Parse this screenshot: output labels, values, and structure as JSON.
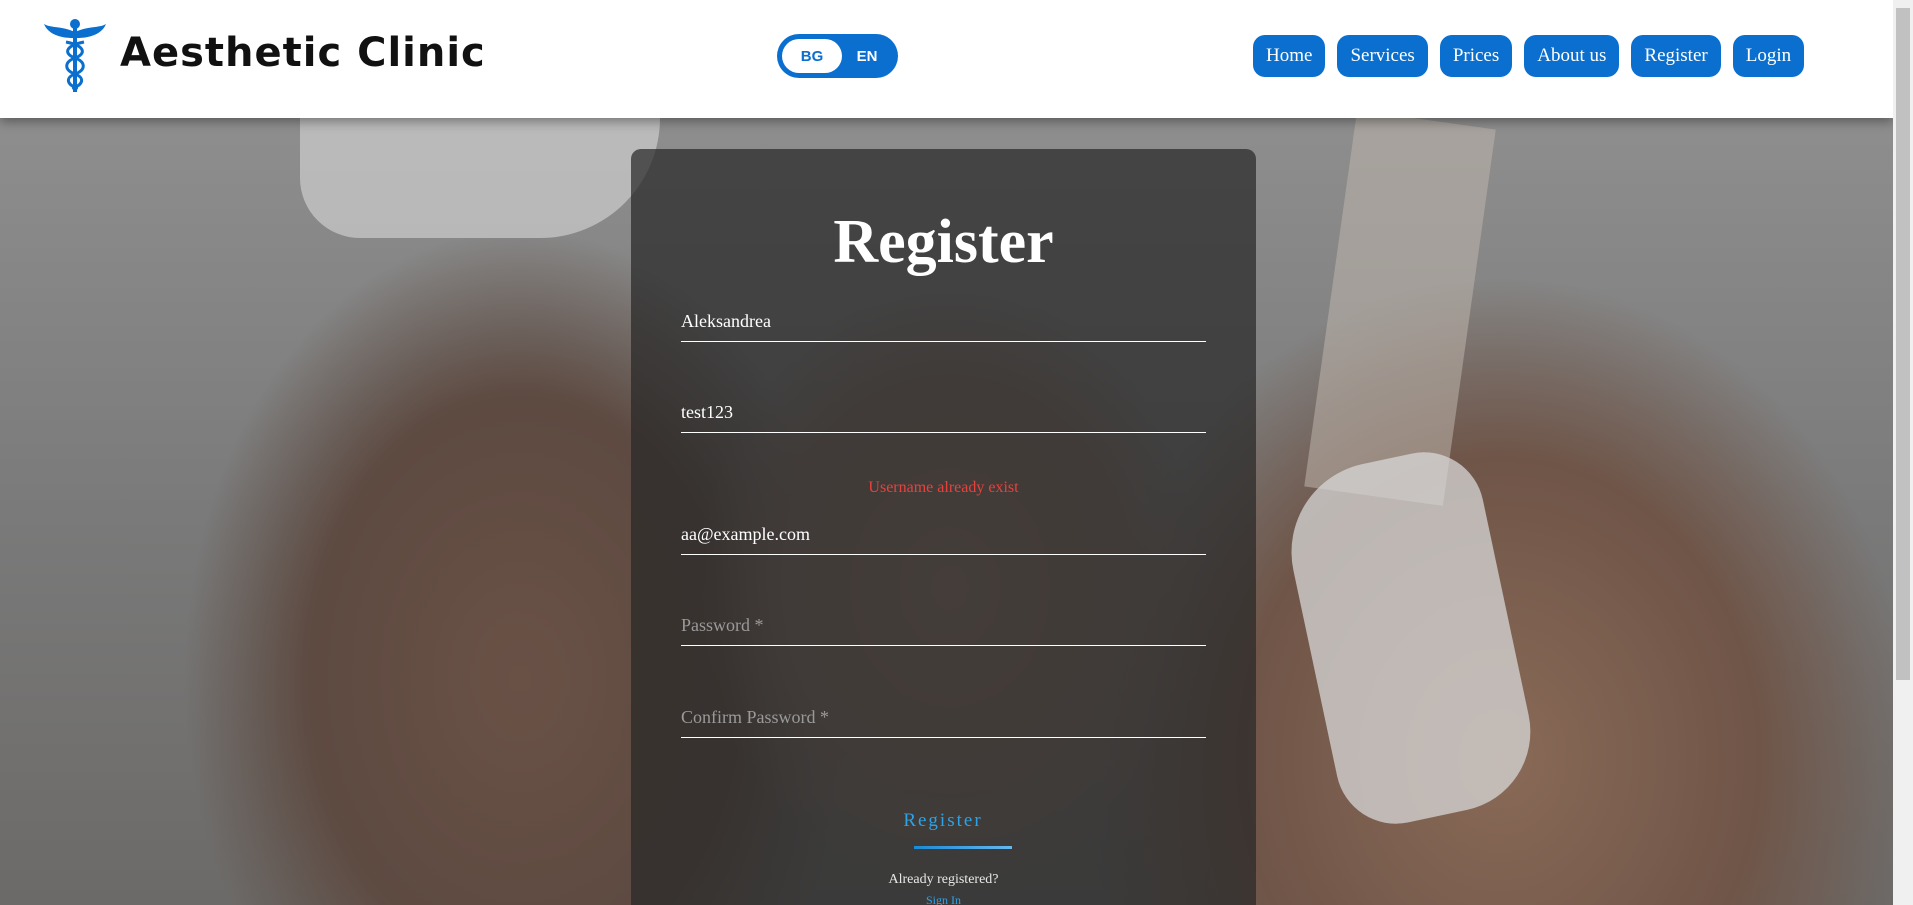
{
  "header": {
    "brand": "Aesthetic Clinic",
    "logo_icon": "caduceus-icon",
    "language": {
      "options": [
        "BG",
        "EN"
      ],
      "selected": "BG"
    },
    "nav": [
      {
        "label": "Home"
      },
      {
        "label": "Services"
      },
      {
        "label": "Prices"
      },
      {
        "label": "About us"
      },
      {
        "label": "Register"
      },
      {
        "label": "Login"
      }
    ]
  },
  "form": {
    "title": "Register",
    "fields": {
      "name": {
        "value": "Aleksandrea",
        "placeholder": ""
      },
      "username": {
        "value": "test123",
        "placeholder": ""
      },
      "email": {
        "value": "aa@example.com",
        "placeholder": ""
      },
      "password": {
        "value": "",
        "placeholder": "Password *"
      },
      "confirm_password": {
        "value": "",
        "placeholder": "Confirm Password *"
      }
    },
    "error": "Username already exist",
    "submit_label": "Register",
    "already_registered": "Already registered?",
    "sign_in": "Sign In"
  },
  "colors": {
    "accent": "#0a6fce",
    "error": "#e8413e",
    "link": "#2ea2e6"
  }
}
